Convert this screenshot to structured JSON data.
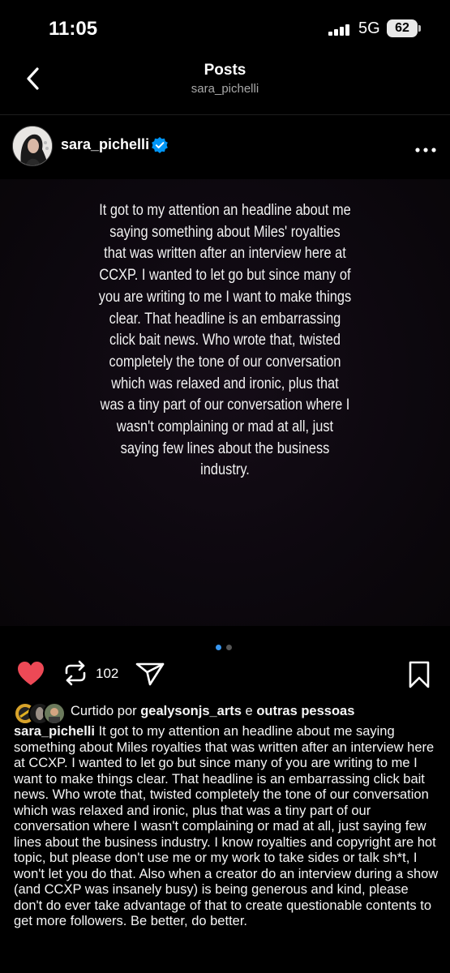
{
  "status_bar": {
    "time": "11:05",
    "network": "5G",
    "battery": "62"
  },
  "header": {
    "title": "Posts",
    "subtitle": "sara_pichelli"
  },
  "post": {
    "author": "sara_pichelli",
    "image_text": "It got to my attention an headline about me saying something about Miles' royalties that was written after an interview here at CCXP. I wanted to let go but since many of you are writing to me I want to make things clear. That headline is an embarrassing click bait news. Who wrote that, twisted completely the tone of our conversation which was relaxed and ironic, plus that was a tiny part of our conversation where I wasn't complaining or mad at all, just saying few lines about the business industry.",
    "repost_count": "102",
    "liked_by": {
      "prefix": "Curtido por",
      "user": "gealysonjs_arts",
      "joiner": "e",
      "others": "outras pessoas"
    },
    "caption_author": "sara_pichelli",
    "caption_text": "It got to my attention an headline about me saying something about Miles royalties that was written after an interview here at CCXP. I wanted to let go but since many of you are writing to me I want to make things clear. That headline is an embarrassing click bait news. Who wrote that, twisted completely the tone of our conversation which was relaxed and ironic, plus that was a tiny part of our conversation where I wasn't complaining or mad at all, just saying few lines about the business industry. I know royalties and copyright are hot topic, but please don't use me or my work to take sides or talk sh*t, I won't let you do that. Also when a creator do an interview during a show (and CCXP was insanely busy) is being generous and kind, please don't do ever take advantage of that to create questionable contents to get more followers. Be better, do better."
  },
  "icons": [
    "back-chevron-icon",
    "verified-badge-icon",
    "more-options-icon",
    "heart-icon",
    "repost-icon",
    "share-icon",
    "bookmark-icon"
  ],
  "colors": {
    "like": "#ed4956",
    "verified": "#0095f6",
    "active_dot": "#3897f0",
    "muted": "#a8a8a8"
  }
}
